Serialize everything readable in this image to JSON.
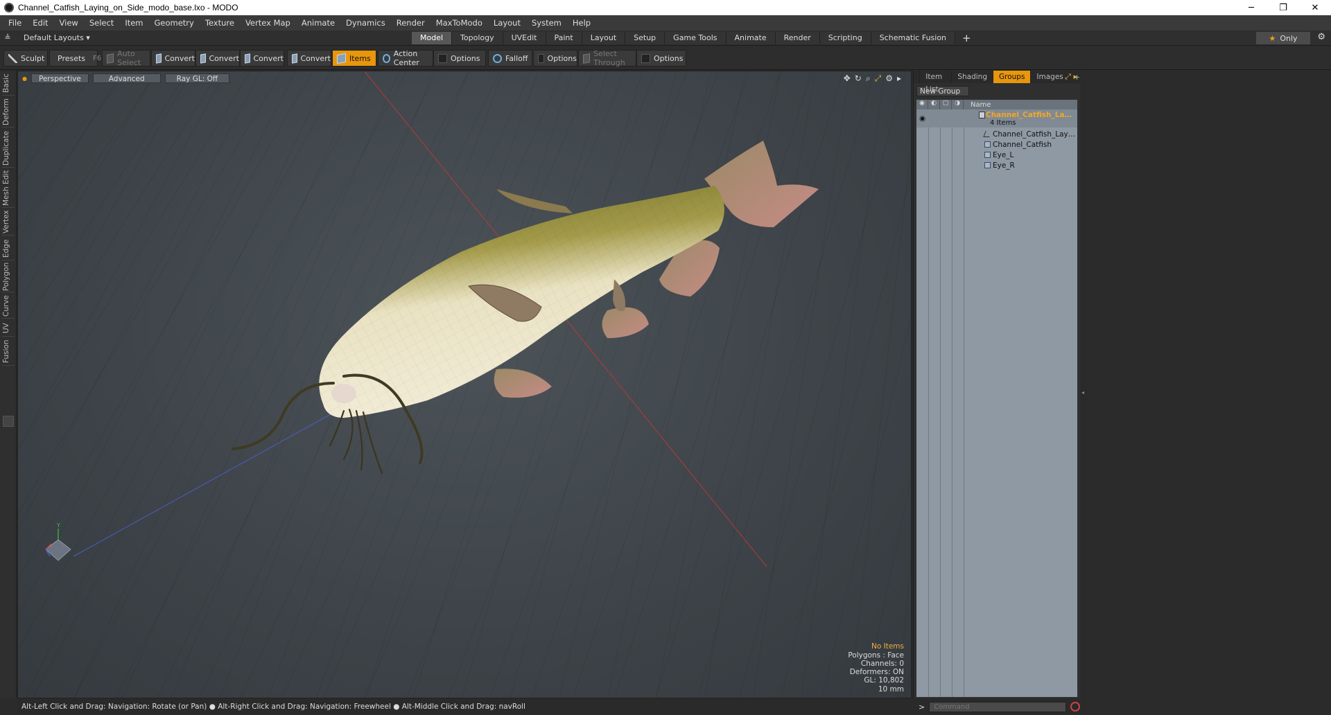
{
  "window": {
    "title": "Channel_Catfish_Laying_on_Side_modo_base.lxo - MODO",
    "minimize": "─",
    "maximize": "❐",
    "close": "✕"
  },
  "menu": [
    "File",
    "Edit",
    "View",
    "Select",
    "Item",
    "Geometry",
    "Texture",
    "Vertex Map",
    "Animate",
    "Dynamics",
    "Render",
    "MaxToModo",
    "Layout",
    "System",
    "Help"
  ],
  "layoutbar": {
    "layouts_dropdown": "Default Layouts ▾",
    "tabs": [
      "Model",
      "Topology",
      "UVEdit",
      "Paint",
      "Layout",
      "Setup",
      "Game Tools",
      "Animate",
      "Render",
      "Scripting",
      "Schematic Fusion"
    ],
    "active_tab": "Model",
    "only_label": "Only"
  },
  "toolbar": {
    "sculpt": "Sculpt",
    "presets": "Presets",
    "presets_key": "F6",
    "auto_select": "Auto Select",
    "convert": "Convert",
    "items": "Items",
    "action_center": "Action Center",
    "options": "Options",
    "falloff": "Falloff",
    "select_through": "Select Through"
  },
  "left_tabs": [
    "Basic",
    "Deform",
    "Duplicate",
    "Mesh Edit",
    "Vertex",
    "Edge",
    "Polygon",
    "Curve",
    "UV",
    "Fusion"
  ],
  "viewport": {
    "view_mode": "Perspective",
    "shading": "Advanced",
    "raygl": "Ray GL: Off",
    "info": {
      "selection": "No Items",
      "polygons": "Polygons : Face",
      "channels": "Channels: 0",
      "deformers": "Deformers: ON",
      "gl": "GL: 10,802",
      "units": "10 mm"
    },
    "axis_y": "Y"
  },
  "statusbar": {
    "hint": "Alt-Left Click and Drag: Navigation: Rotate (or Pan) ● Alt-Right Click and Drag: Navigation: Freewheel ● Alt-Middle Click and Drag: navRoll"
  },
  "right_panel": {
    "tabs": [
      "Item List",
      "Shading",
      "Groups",
      "Images"
    ],
    "active_tab": "Groups",
    "new_group": "New Group",
    "column_name": "Name",
    "group": {
      "name": "Channel_Catfish_Laying_ ...",
      "count": "4 Items"
    },
    "items": [
      "Channel_Catfish_Laying_on...",
      "Channel_Catfish",
      "Eye_L",
      "Eye_R"
    ]
  },
  "command": {
    "placeholder": "Command"
  },
  "colors": {
    "accent": "#e8960c",
    "viewport_bg": "#3e4449",
    "group_name": "#f5a623"
  }
}
